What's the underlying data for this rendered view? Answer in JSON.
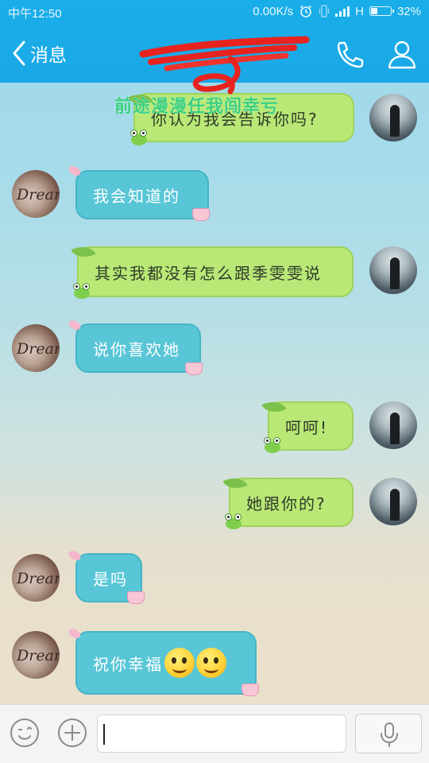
{
  "status_bar": {
    "time": "中午12:50",
    "network_speed": "0.00K/s",
    "network_type": "H",
    "battery_percent": "32%",
    "battery_level": 0.32,
    "icons": [
      "alarm-icon",
      "vibrate-icon",
      "signal-icon",
      "battery-icon"
    ]
  },
  "header": {
    "back_label": "消息",
    "contact_name_redacted": true,
    "call_icon": "phone-icon",
    "profile_icon": "person-icon",
    "bg_color": "#1aaae7"
  },
  "overlay_caption": "前途漫漫任我闯幸亏",
  "messages": [
    {
      "side": "right",
      "text": "你认为我会告诉你吗?"
    },
    {
      "side": "left",
      "text": "我会知道的"
    },
    {
      "side": "right",
      "text": "其实我都没有怎么跟季雯雯说"
    },
    {
      "side": "left",
      "text": "说你喜欢她"
    },
    {
      "side": "right",
      "text": "呵呵!"
    },
    {
      "side": "right",
      "text": "她跟你的?"
    },
    {
      "side": "left",
      "text": "是吗"
    },
    {
      "side": "left",
      "text": "祝你幸福",
      "emojis": [
        "smile-emoji-icon",
        "thinking-emoji-icon"
      ]
    }
  ],
  "avatars": {
    "me": "silhouette-avatar",
    "other_text": "Dream"
  },
  "input_bar": {
    "value": "",
    "emoji_icon": "smiley-icon",
    "more_icon": "plus-icon",
    "voice_icon": "microphone-icon"
  },
  "colors": {
    "my_bubble": "#b9e876",
    "their_bubble": "#58c6d6",
    "overlay_text": "#3ad07f"
  }
}
